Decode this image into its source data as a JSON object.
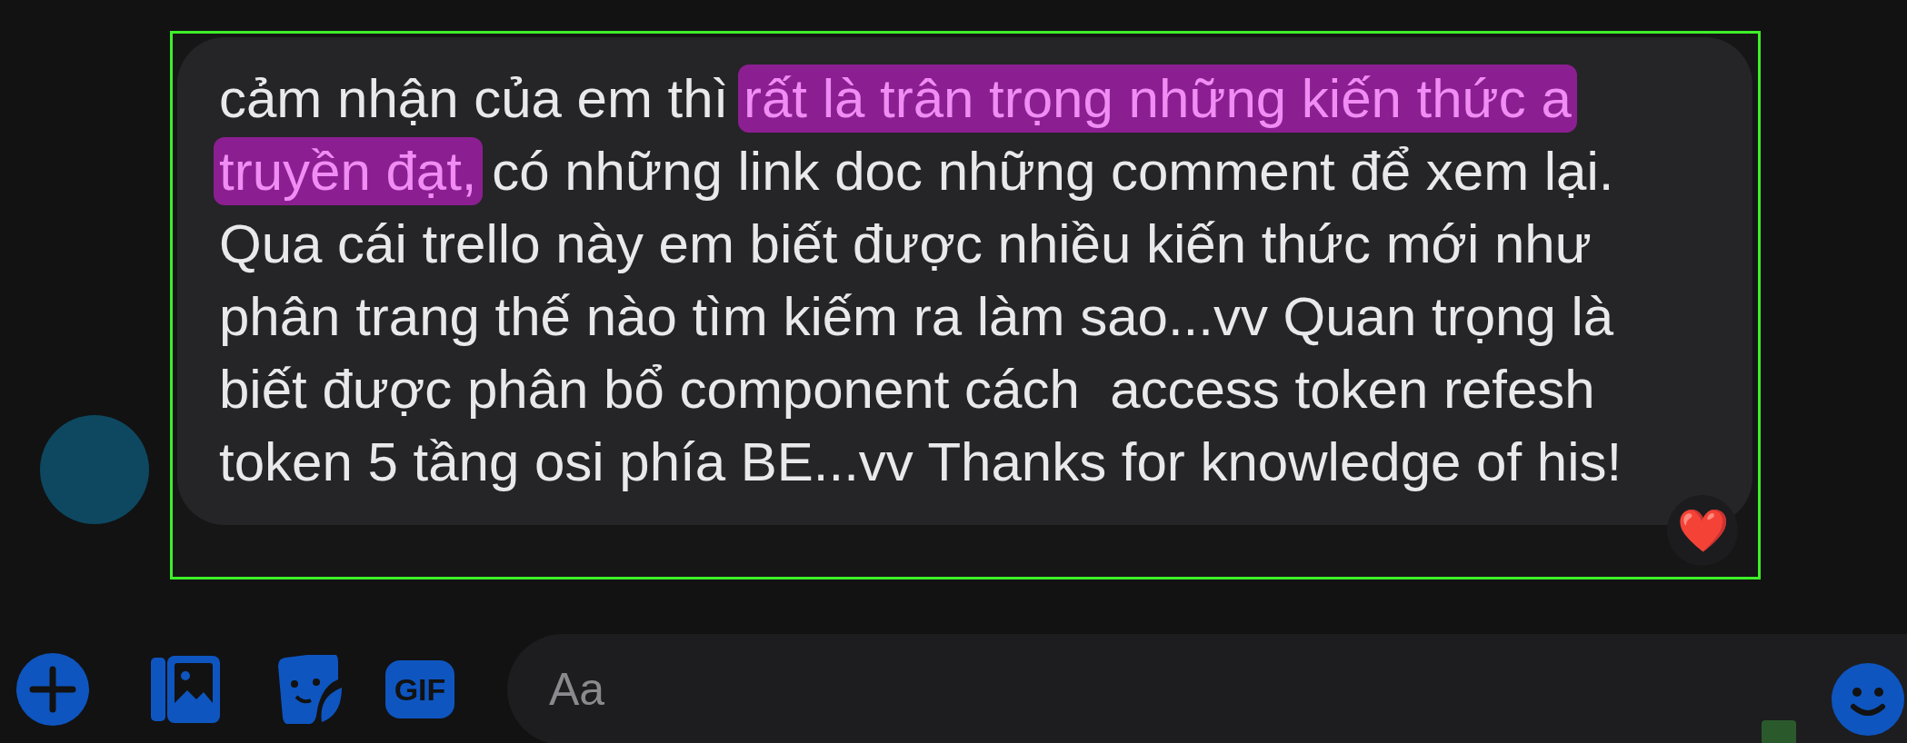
{
  "message": {
    "lines": [
      [
        {
          "text": "cảm nhận của em thì ",
          "highlighted": false
        },
        {
          "text": "rất là trân trọng những kiến thức a",
          "highlighted": true
        }
      ],
      [
        {
          "text": "truyền đạt,",
          "highlighted": true
        },
        {
          "text": " có những link doc những comment để xem lại.",
          "highlighted": false
        }
      ],
      [
        {
          "text": "Qua cái trello này em biết được nhiều kiến thức mới như",
          "highlighted": false
        }
      ],
      [
        {
          "text": "phân trang thế nào tìm kiếm ra làm sao...vv Quan trọng là",
          "highlighted": false
        }
      ],
      [
        {
          "text": "biết được phân bổ component cách  access token refesh",
          "highlighted": false
        }
      ],
      [
        {
          "text": "token 5 tầng osi phía BE...vv Thanks for knowledge of his!",
          "highlighted": false
        }
      ]
    ],
    "reaction": "❤️"
  },
  "composer": {
    "gif_label": "GIF",
    "placeholder": "Aa"
  }
}
